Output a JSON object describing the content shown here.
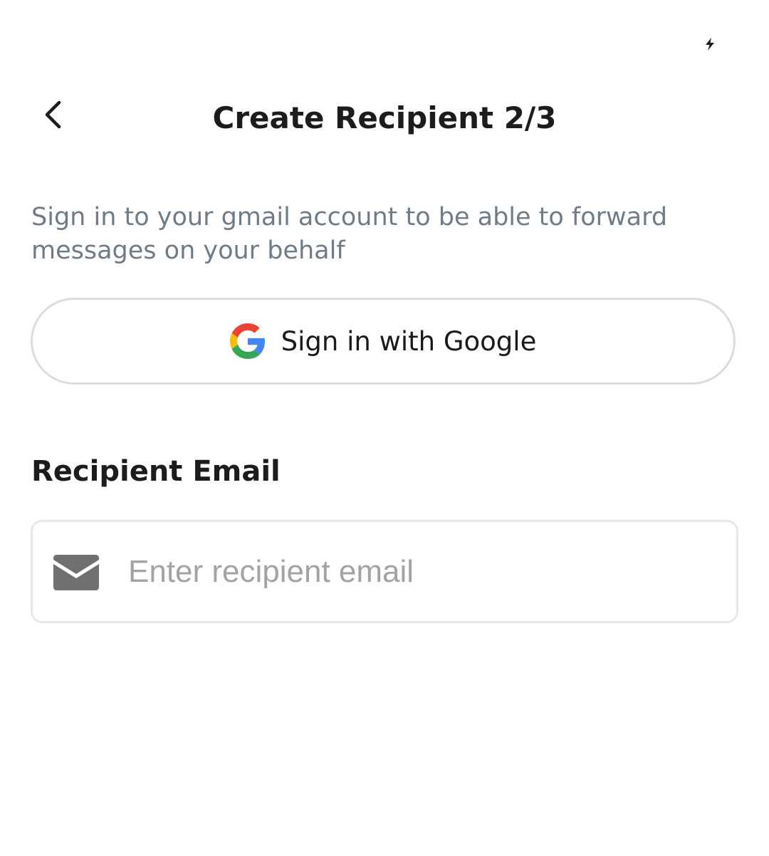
{
  "status_bar": {
    "icon": "charging-bolt-icon"
  },
  "header": {
    "back_icon": "chevron-left-icon",
    "title": "Create Recipient 2/3"
  },
  "instruction": {
    "text": "Sign in to your gmail account to be able to forward messages on your behalf"
  },
  "google_button": {
    "icon": "google-g-icon",
    "label": "Sign in with Google"
  },
  "recipient_email": {
    "label": "Recipient Email",
    "icon": "mail-envelope-icon",
    "value": "",
    "placeholder": "Enter recipient email"
  },
  "colors": {
    "title_text": "#1c1c1e",
    "instruction_text": "#6f7c88",
    "button_border": "#dcdcdc",
    "field_border": "#e3e8ee",
    "placeholder_text": "#a3a3a3",
    "icon_gray": "#707070",
    "google_blue": "#4285F4",
    "google_red": "#EA4335",
    "google_yellow": "#FBBC05",
    "google_green": "#34A853"
  }
}
